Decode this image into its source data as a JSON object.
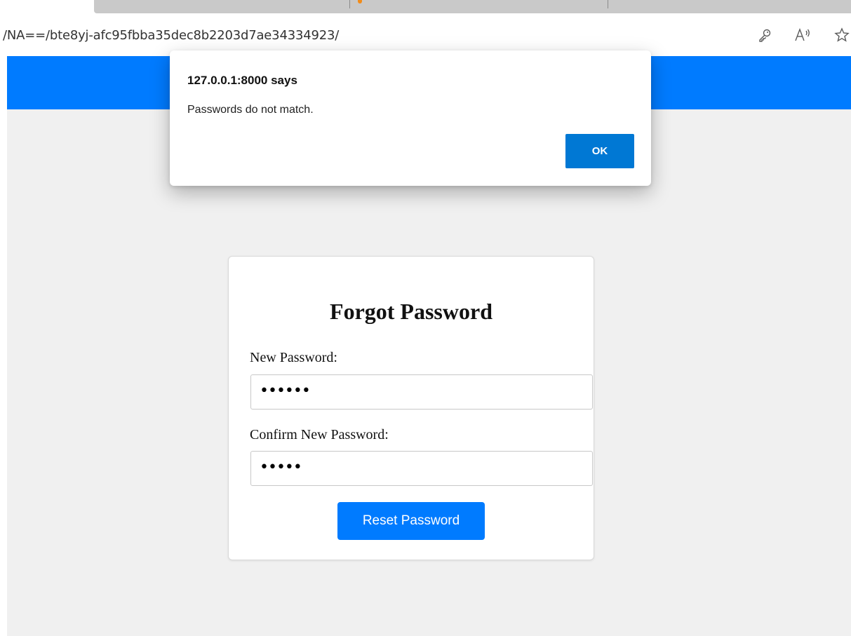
{
  "browser": {
    "url": "/NA==/bte8yj-afc95fbba35dec8b2203d7ae34334923/",
    "icons": {
      "key": "key-icon",
      "read_aloud": "read-aloud-icon",
      "favorite": "favorite-star-icon"
    },
    "tab_loading_color": "#f28c1a"
  },
  "alert": {
    "title": "127.0.0.1:8000 says",
    "message": "Passwords do not match.",
    "ok_label": "OK",
    "ok_color": "#0078d4"
  },
  "page": {
    "header_color": "#007bff",
    "background_color": "#f0f0f0",
    "form": {
      "title": "Forgot Password",
      "new_password_label": "New Password:",
      "new_password_value": "••••••",
      "confirm_password_label": "Confirm New Password:",
      "confirm_password_value": "•••••",
      "submit_label": "Reset Password",
      "submit_color": "#007bff"
    }
  }
}
